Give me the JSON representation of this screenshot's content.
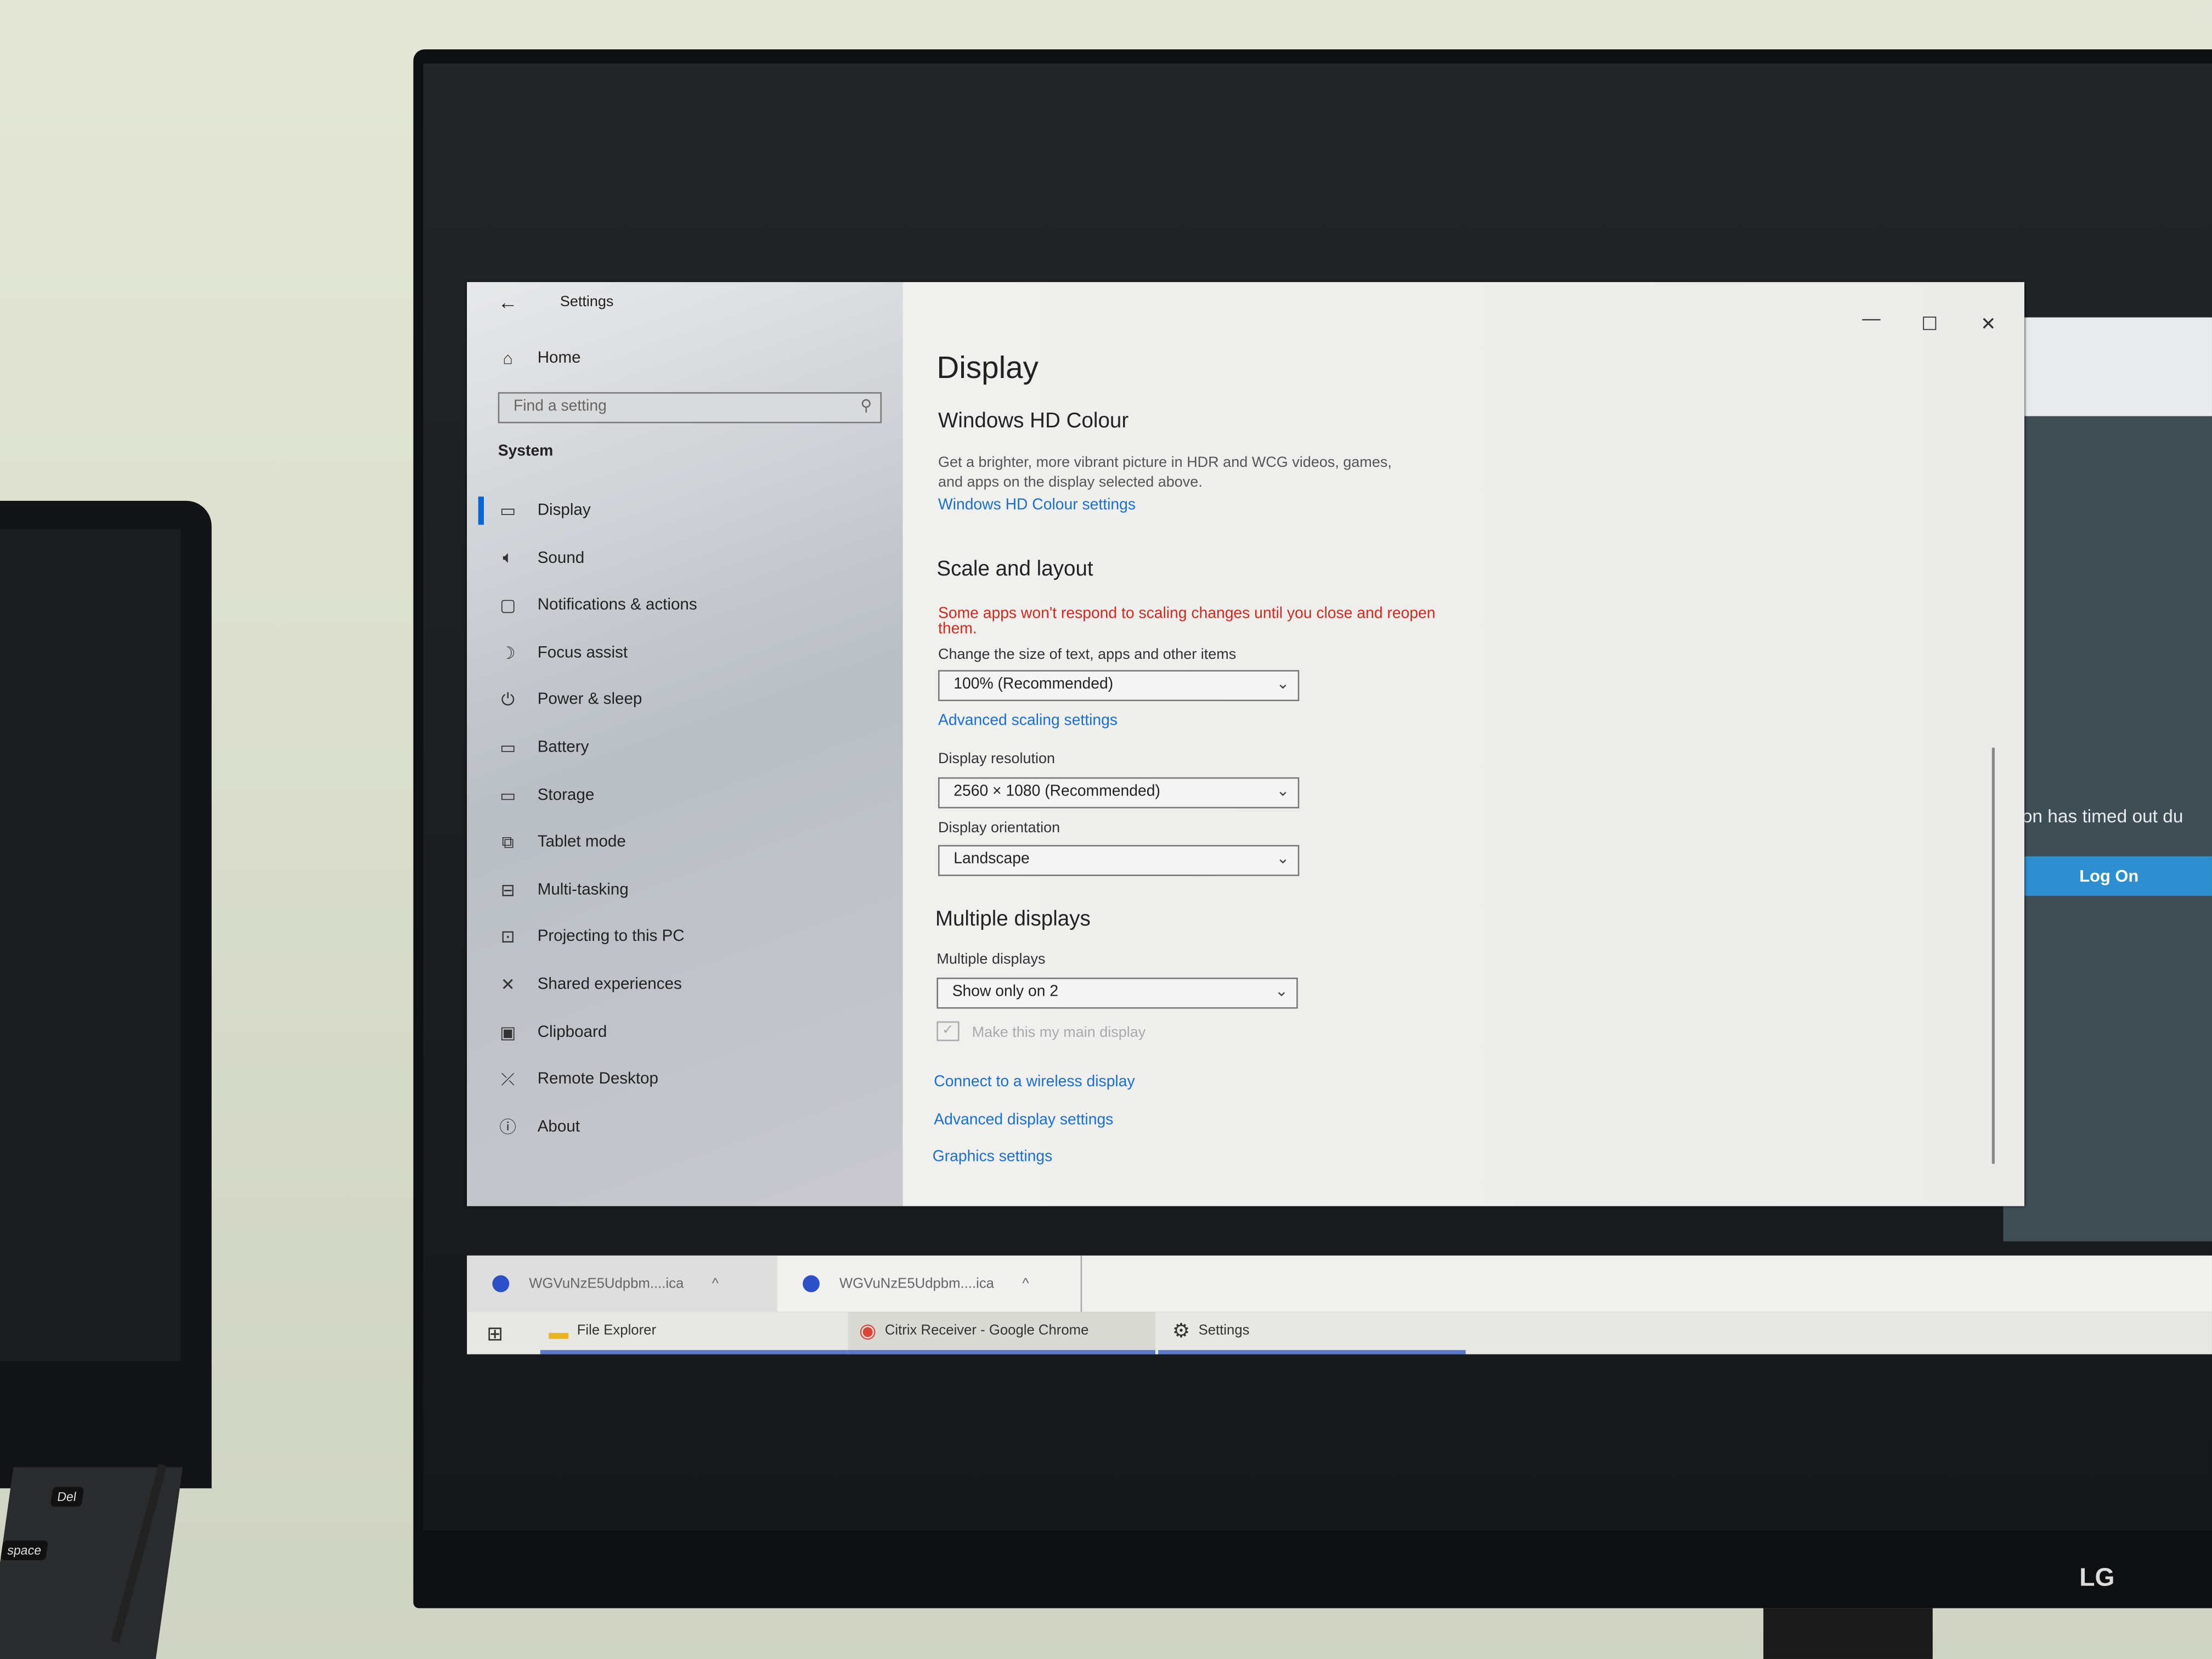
{
  "window": {
    "title": "Settings",
    "back_icon": "arrow-left-icon",
    "controls": [
      "minimize",
      "maximize",
      "close"
    ]
  },
  "sidebar": {
    "home": "Home",
    "search_placeholder": "Find a setting",
    "section": "System",
    "selected": "Display",
    "items": [
      {
        "label": "Display",
        "icon": "monitor-icon"
      },
      {
        "label": "Sound",
        "icon": "speaker-icon"
      },
      {
        "label": "Notifications & actions",
        "icon": "message-icon"
      },
      {
        "label": "Focus assist",
        "icon": "moon-icon"
      },
      {
        "label": "Power & sleep",
        "icon": "power-icon"
      },
      {
        "label": "Battery",
        "icon": "battery-icon"
      },
      {
        "label": "Storage",
        "icon": "storage-icon"
      },
      {
        "label": "Tablet mode",
        "icon": "tablet-icon"
      },
      {
        "label": "Multi-tasking",
        "icon": "multitask-icon"
      },
      {
        "label": "Projecting to this PC",
        "icon": "project-icon"
      },
      {
        "label": "Shared experiences",
        "icon": "shared-icon"
      },
      {
        "label": "Clipboard",
        "icon": "clipboard-icon"
      },
      {
        "label": "Remote Desktop",
        "icon": "remote-icon"
      },
      {
        "label": "About",
        "icon": "info-icon"
      }
    ]
  },
  "main": {
    "title": "Display",
    "hd": {
      "heading": "Windows HD Colour",
      "desc1": "Get a brighter, more vibrant picture in HDR and WCG videos, games,",
      "desc2": "and apps on the display selected above.",
      "link": "Windows HD Colour settings"
    },
    "scale": {
      "heading": "Scale and layout",
      "warning1": "Some apps won't respond to scaling changes until you close and reopen",
      "warning2": "them.",
      "size_label": "Change the size of text, apps and other items",
      "size_value": "100% (Recommended)",
      "advanced_link": "Advanced scaling settings",
      "resolution_label": "Display resolution",
      "resolution_value": "2560 × 1080 (Recommended)",
      "orientation_label": "Display orientation",
      "orientation_value": "Landscape"
    },
    "multiple": {
      "heading": "Multiple displays",
      "label": "Multiple displays",
      "value": "Show only on 2",
      "checkbox_label": "Make this my main display",
      "checkbox_checked": true,
      "links": [
        "Connect to a wireless display",
        "Advanced display settings",
        "Graphics settings"
      ]
    }
  },
  "background_app": {
    "message": "sion has timed out du",
    "button": "Log On",
    "button_color": "#2d8fd0"
  },
  "downloads": [
    {
      "name": "WGVuNzE5Udpbm....ica"
    },
    {
      "name": "WGVuNzE5Udpbm....ica"
    }
  ],
  "taskbar": {
    "items": [
      "File Explorer",
      "Citrix Receiver - Google Chrome",
      "Settings"
    ]
  },
  "laptop_keys": [
    "Del",
    "space"
  ],
  "monitor_brand": "LG",
  "colors": {
    "accent": "#0a64d6",
    "link": "#1a6fd0",
    "warning": "#d22a1e"
  }
}
